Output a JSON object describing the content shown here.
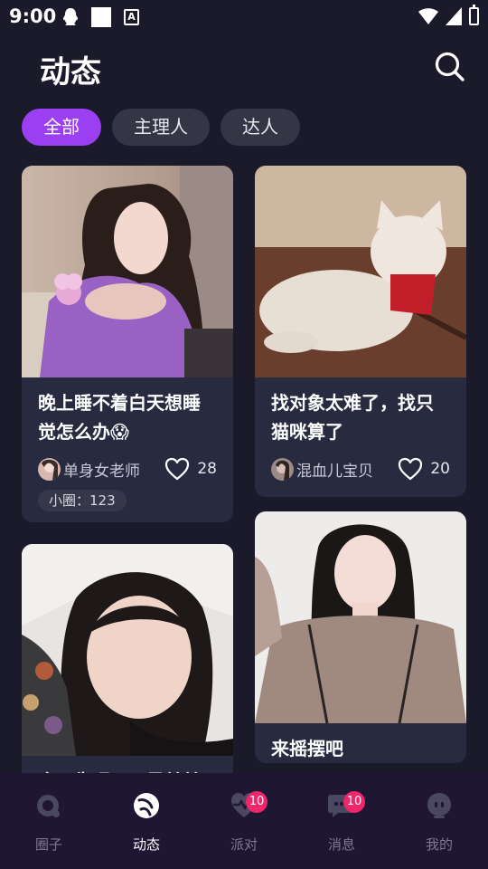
{
  "status_bar": {
    "time": "9:00",
    "icons": [
      "qq-icon",
      "square-icon",
      "a-icon",
      "wifi-icon",
      "signal-icon",
      "battery-icon"
    ]
  },
  "header": {
    "title": "动态",
    "search_icon": "search-icon"
  },
  "tabs": [
    {
      "label": "全部",
      "active": true
    },
    {
      "label": "主理人",
      "active": false
    },
    {
      "label": "达人",
      "active": false
    }
  ],
  "posts": [
    {
      "title": "晚上睡不着白天想睡觉怎么办😱",
      "author": "单身女老师",
      "likes": "28",
      "circle": "小圈：123",
      "image": "girl-purple-sweater-photo"
    },
    {
      "title": "找对象太难了，找只猫咪算了",
      "author": "混血儿宝贝",
      "likes": "20",
      "image": "white-cat-photo"
    },
    {
      "title": "今天失眠了又是单单",
      "image": "girl-selfie-pillow-photo"
    },
    {
      "title": "来摇摆吧",
      "image": "girl-knit-top-photo"
    }
  ],
  "nav": [
    {
      "label": "圈子",
      "icon": "circle-icon",
      "active": false
    },
    {
      "label": "动态",
      "icon": "moments-icon",
      "active": true
    },
    {
      "label": "派对",
      "icon": "party-icon",
      "active": false,
      "badge": "10"
    },
    {
      "label": "消息",
      "icon": "message-icon",
      "active": false,
      "badge": "10"
    },
    {
      "label": "我的",
      "icon": "profile-icon",
      "active": false
    }
  ],
  "colors": {
    "background": "#1b1a2b",
    "accent": "#9b3ff3",
    "card": "#282a40",
    "badge": "#f0256a"
  }
}
